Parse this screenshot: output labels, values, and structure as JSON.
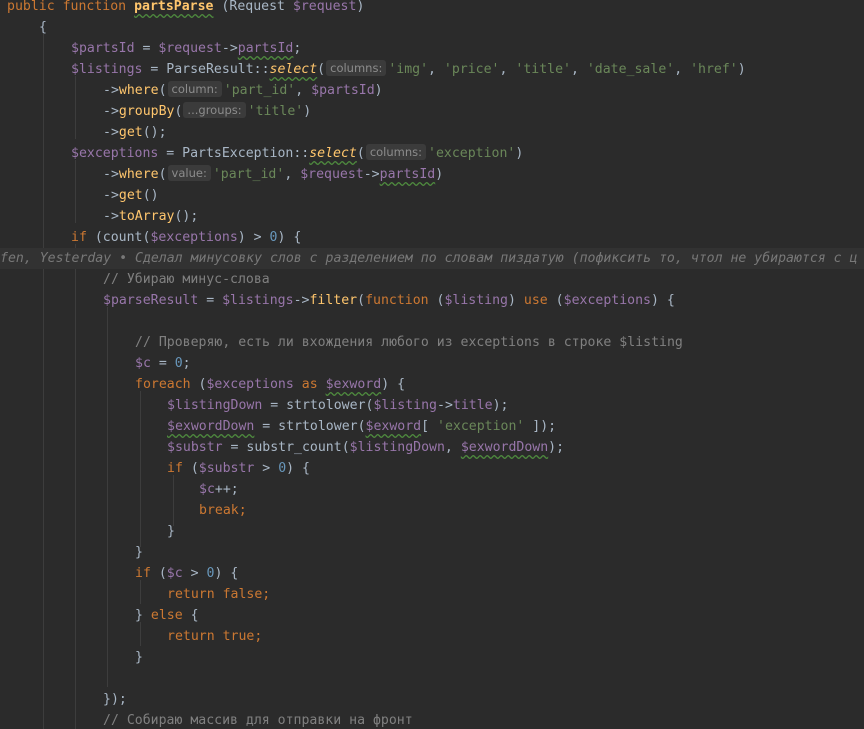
{
  "editor": {
    "blame": {
      "author_fragment": "fen, Yesterday",
      "separator": " • ",
      "message": "Сделал минусовку слов с разделением по словам пиздатую (пофиксить то, чтол не убираются с ц"
    },
    "hints": {
      "columns": "columns:",
      "column": "column:",
      "groups": "...groups:",
      "value": "value:"
    },
    "tokens": {
      "public": "public",
      "function": "function",
      "method_name": "partsParse",
      "request_type": "Request",
      "request_var": "$request",
      "open_brace": "{",
      "close_brace": "}",
      "partsId_var": "$partsId",
      "partsId_prop": "partsId",
      "listings_var": "$listings",
      "parse_result_class": "ParseResult",
      "select": "select",
      "where": "where",
      "groupBy": "groupBy",
      "get": "get",
      "toArray": "toArray",
      "exceptions_var": "$exceptions",
      "parts_exception_class": "PartsException",
      "str_img": "'img'",
      "str_price": "'price'",
      "str_title": "'title'",
      "str_date_sale": "'date_sale'",
      "str_href": "'href'",
      "str_part_id": "'part_id'",
      "str_exception": "'exception'",
      "if": "if",
      "count": "count",
      "zero": "0",
      "comment_minus": "// Убираю минус-слова",
      "parse_result_var": "$parseResult",
      "filter": "filter",
      "listing_var": "$listing",
      "use": "use",
      "comment_check": "// Проверяю, есть ли вхождения любого из exceptions в строке $listing",
      "c_var": "$c",
      "foreach": "foreach",
      "as": "as",
      "exword_var": "$exword",
      "listing_down_var": "$listingDown",
      "strtolower": "strtolower",
      "title_prop": "title",
      "exword_down_var": "$exwordDown",
      "substr_var": "$substr",
      "substr_count": "substr_count",
      "break": "break",
      "return": "return",
      "false": "false",
      "true": "true",
      "else": "else",
      "comment_collect": "// Собираю массив для отправки на фронт"
    }
  }
}
